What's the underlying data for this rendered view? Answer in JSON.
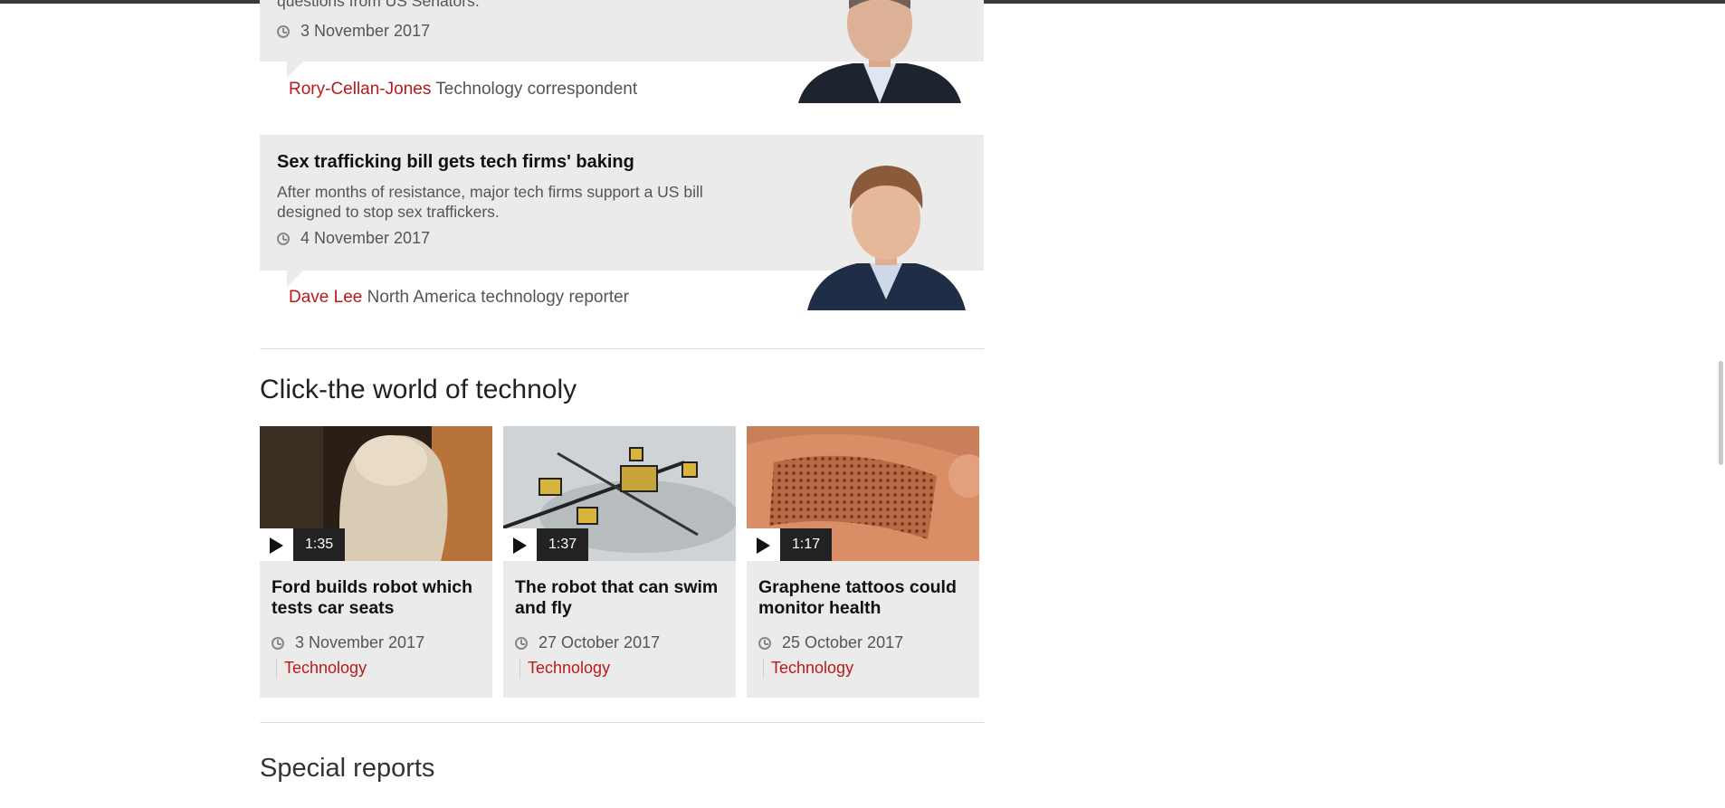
{
  "correspondents": [
    {
      "summary_tail": "questions from US Senators.",
      "date": "3 November 2017",
      "author": "Rory-Cellan-Jones",
      "role": "Technology correspondent"
    },
    {
      "headline": "Sex trafficking bill gets tech firms' baking",
      "summary": "After months of resistance, major tech firms support a US bill designed to stop sex traffickers.",
      "date": "4 November 2017",
      "author": "Dave Lee",
      "role": "North America technology reporter"
    }
  ],
  "video_section": {
    "title": "Click-the world of technoly",
    "items": [
      {
        "duration": "1:35",
        "title": "Ford builds robot which tests car seats",
        "date": "3 November 2017",
        "tag": "Technology"
      },
      {
        "duration": "1:37",
        "title": "The robot that can swim and fly",
        "date": "27 October 2017",
        "tag": "Technology"
      },
      {
        "duration": "1:17",
        "title": "Graphene tattoos could monitor health",
        "date": "25 October 2017",
        "tag": "Technology"
      }
    ]
  },
  "special_reports": {
    "title": "Special reports"
  },
  "colors": {
    "accent": "#bb1919",
    "card_bg": "#ebebeb"
  }
}
